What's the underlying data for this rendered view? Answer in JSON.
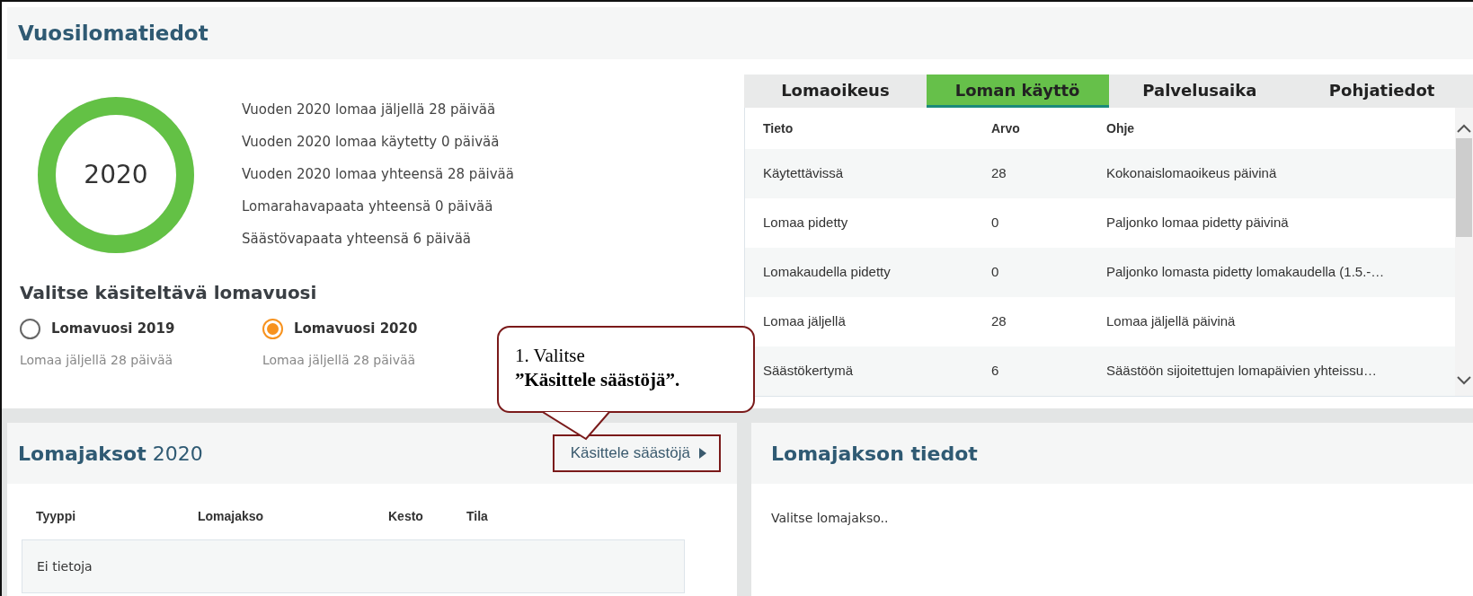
{
  "page_title": "Vuosilomatiedot",
  "summary": {
    "ring": {
      "label": "2020",
      "level": 1
    },
    "lines": [
      "Vuoden 2020 lomaa jäljellä 28 päivää",
      "Vuoden 2020 lomaa käytetty 0 päivää",
      "Vuoden 2020 lomaa yhteensä 28 päivää",
      "Lomarahavapaata yhteensä 0 päivää",
      "Säästövapaata yhteensä 6 päivää"
    ]
  },
  "year_picker": {
    "title": "Valitse käsiteltävä lomavuosi",
    "options": [
      {
        "label": "Lomavuosi 2019",
        "note": "Lomaa jäljellä 28 päivää",
        "selected": false
      },
      {
        "label": "Lomavuosi 2020",
        "note": "Lomaa jäljellä 28 päivää",
        "selected": true
      }
    ]
  },
  "tabs": [
    {
      "label": "Lomaoikeus",
      "selected": false
    },
    {
      "label": "Loman käyttö",
      "selected": true
    },
    {
      "label": "Palvelusaika",
      "selected": false
    },
    {
      "label": "Pohjatiedot",
      "selected": false
    }
  ],
  "usage_table": {
    "columns": [
      "Tieto",
      "Arvo",
      "Ohje"
    ],
    "rows": [
      [
        "Käytettävissä",
        "28",
        "Kokonaislomaoikeus päivinä"
      ],
      [
        "Lomaa pidetty",
        "0",
        "Paljonko lomaa pidetty päivinä"
      ],
      [
        "Lomakaudella pidetty",
        "0",
        "Paljonko lomasta pidetty lomakaudella (1.5.-…"
      ],
      [
        "Lomaa jäljellä",
        "28",
        "Lomaa jäljellä päivinä"
      ],
      [
        "Säästökertymä",
        "6",
        "Säästöön sijoitettujen lomapäivien yhteissu…"
      ]
    ]
  },
  "periods": {
    "title": "Lomajaksot",
    "year": "2020",
    "action": "Käsittele säästöjä",
    "columns": [
      "Tyyppi",
      "Lomajakso",
      "Kesto",
      "Tila"
    ],
    "empty_text": "Ei tietoja"
  },
  "details": {
    "title": "Lomajakson tiedot",
    "hint": "Valitse lomajakso.."
  },
  "callout": {
    "text": "1. Valitse\n**”Käsittele säästöjä”.**"
  }
}
